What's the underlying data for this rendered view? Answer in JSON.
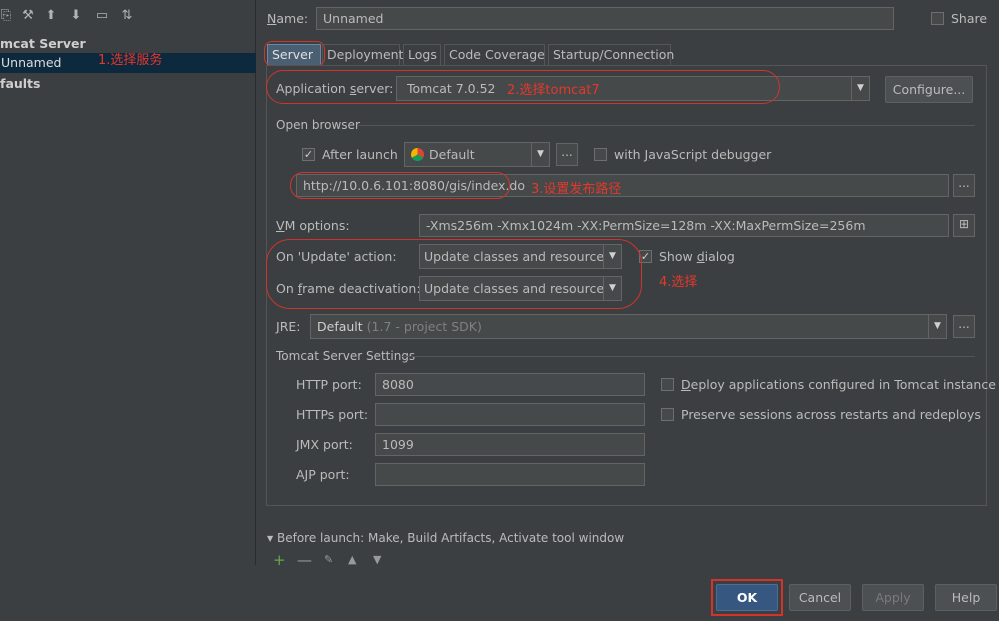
{
  "left": {
    "tree": [
      {
        "label": "mcat Server"
      },
      {
        "label": "Unnamed"
      },
      {
        "label": "faults"
      }
    ]
  },
  "name_label": "Name:",
  "name_value": "Unnamed",
  "share_label": "Share",
  "tabs": [
    "Server",
    "Deployment",
    "Logs",
    "Code Coverage",
    "Startup/Connection"
  ],
  "app_server": {
    "label": "Application server:",
    "value": "Tomcat 7.0.52",
    "configure": "Configure..."
  },
  "open_browser": {
    "title": "Open browser",
    "after_launch": "After launch",
    "browser": "Default",
    "js_debugger": "with JavaScript debugger",
    "url": "http://10.0.6.101:8080/gis/index.do",
    "dots": "..."
  },
  "vm": {
    "label": "VM options:",
    "value": "-Xms256m -Xmx1024m -XX:PermSize=128m -XX:MaxPermSize=256m"
  },
  "update": {
    "label": "On 'Update' action:",
    "value": "Update classes and resources",
    "show_dialog": "Show dialog"
  },
  "deactivation": {
    "label": "On frame deactivation:",
    "value": "Update classes and resources"
  },
  "jre": {
    "label": "JRE:",
    "value": "Default",
    "hint": "(1.7 - project SDK)"
  },
  "tomcat_settings": {
    "title": "Tomcat Server Settings",
    "http_label": "HTTP port:",
    "http_value": "8080",
    "https_label": "HTTPs port:",
    "https_value": "",
    "jmx_label": "JMX port:",
    "jmx_value": "1099",
    "ajp_label": "AJP port:",
    "ajp_value": "",
    "deploy_label": "Deploy applications configured in Tomcat instance",
    "preserve_label": "Preserve sessions across restarts and redeploys"
  },
  "before_launch": "Before launch: Make, Build Artifacts, Activate tool window",
  "buttons": {
    "ok": "OK",
    "cancel": "Cancel",
    "apply": "Apply",
    "help": "Help"
  },
  "annotations": {
    "a1": "1.选择服务",
    "a2": "2.选择tomcat7",
    "a3": "3.设置发布路径",
    "a4": "4.选择"
  },
  "colors": {
    "accent_red": "#d0342c",
    "selection": "#0d293e",
    "ok_button": "#365880"
  }
}
